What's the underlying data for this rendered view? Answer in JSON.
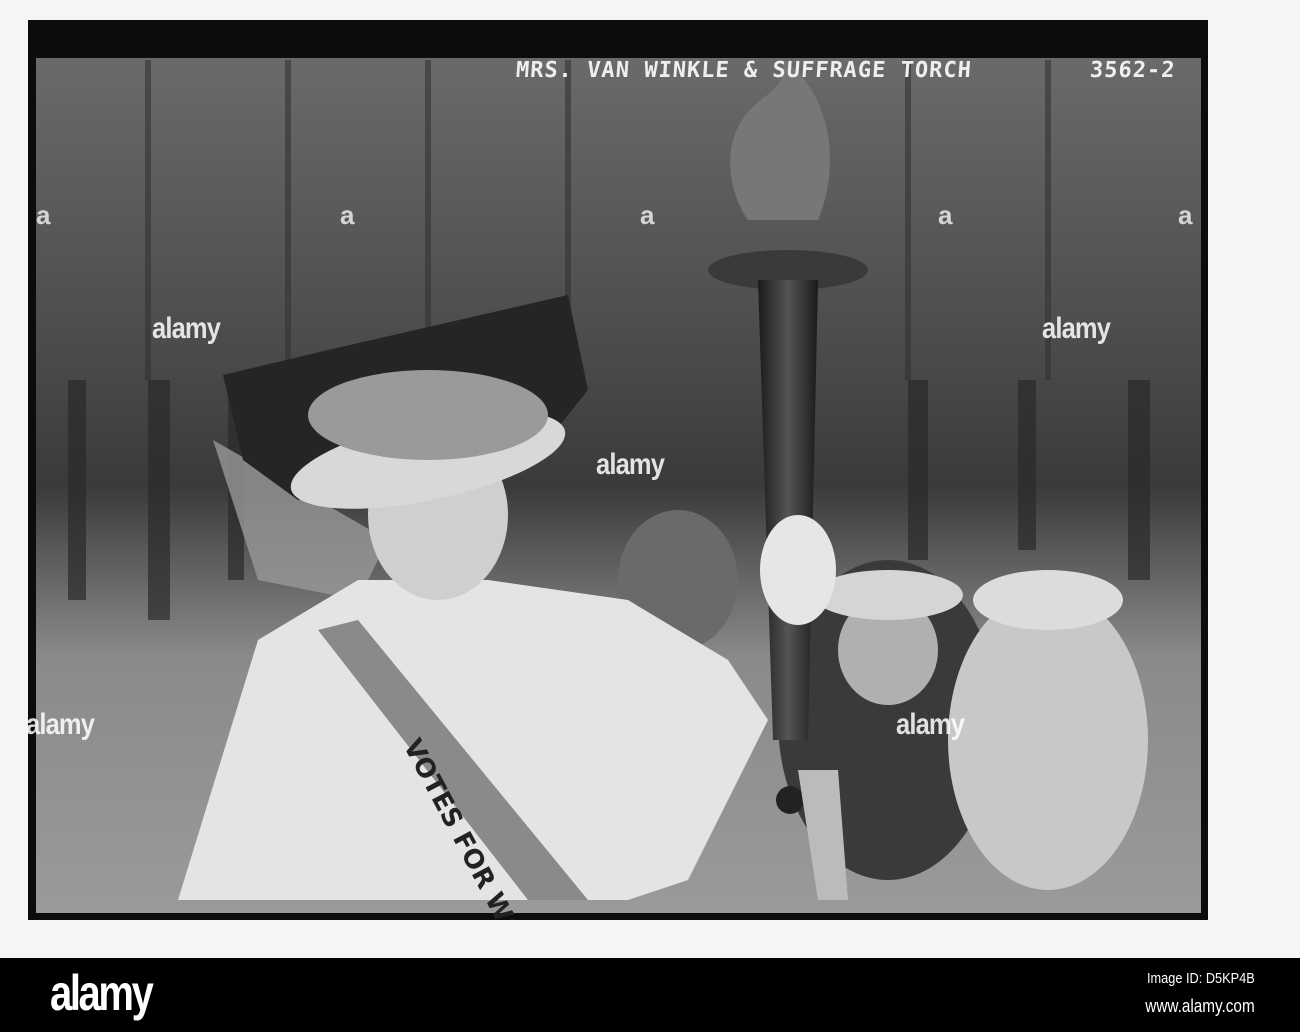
{
  "photo": {
    "caption": "MRS. VAN WINKLE & SUFFRAGE TORCH",
    "negative_number": "3562-2",
    "sash_text": "VOTES FOR WOMEN"
  },
  "watermark": {
    "text": "alamy",
    "letter": "a"
  },
  "footer": {
    "logo": "alamy",
    "image_id": "Image ID: D5KP4B",
    "url": "www.alamy.com"
  }
}
